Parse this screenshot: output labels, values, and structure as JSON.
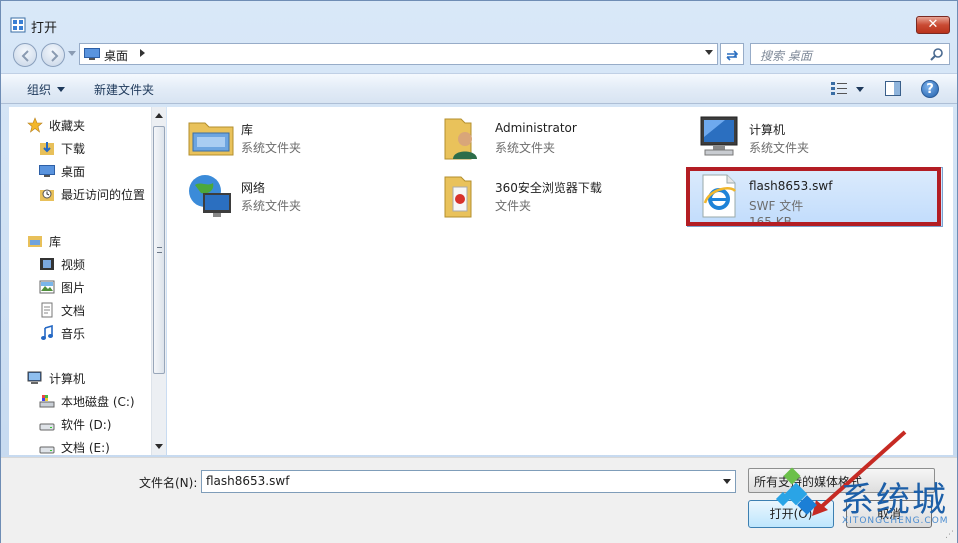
{
  "window": {
    "title": "打开"
  },
  "nav": {
    "address_location": "桌面",
    "search_placeholder": "搜索 桌面"
  },
  "toolbar": {
    "organize_label": "组织",
    "new_folder_label": "新建文件夹"
  },
  "sidebar": {
    "favorites": {
      "label": "收藏夹",
      "items": [
        "下载",
        "桌面",
        "最近访问的位置"
      ]
    },
    "libraries": {
      "label": "库",
      "items": [
        "视频",
        "图片",
        "文档",
        "音乐"
      ]
    },
    "computer": {
      "label": "计算机",
      "items": [
        "本地磁盘 (C:)",
        "软件 (D:)",
        "文档 (E:)"
      ]
    }
  },
  "files": [
    {
      "name": "库",
      "type": "系统文件夹",
      "icon": "library-folder-icon"
    },
    {
      "name": "Administrator",
      "type": "系统文件夹",
      "icon": "user-folder-icon"
    },
    {
      "name": "计算机",
      "type": "系统文件夹",
      "icon": "computer-icon"
    },
    {
      "name": "网络",
      "type": "系统文件夹",
      "icon": "network-icon"
    },
    {
      "name": "360安全浏览器下载",
      "type": "文件夹",
      "icon": "folder-icon"
    },
    {
      "name": "flash8653.swf",
      "type": "SWF 文件",
      "size": "165 KB",
      "icon": "ie-file-icon",
      "selected": true
    }
  ],
  "bottom": {
    "filename_label": "文件名(N):",
    "filename_value": "flash8653.swf",
    "filter_value": "所有支持的媒体格式",
    "open_label": "打开(O)",
    "cancel_label": "取消"
  },
  "watermark": {
    "text": "系统城",
    "sub": "XITONGCHENG.COM"
  },
  "colors": {
    "highlight": "#b31d23",
    "selection": "#c1dcfc",
    "accent": "#1c5fa8"
  }
}
